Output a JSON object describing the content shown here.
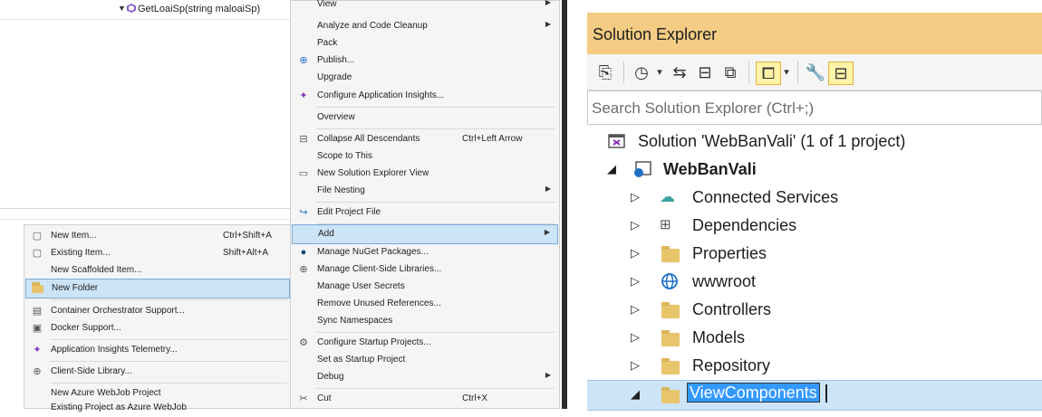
{
  "editor": {
    "nav_method": "GetLoaiSp(string maloaiSp)"
  },
  "context_menu": {
    "items": [
      {
        "label": "View",
        "shortcut": "",
        "submenu": true
      },
      {
        "label": "Analyze and Code Cleanup",
        "shortcut": "",
        "submenu": true
      },
      {
        "label": "Pack",
        "shortcut": "",
        "submenu": false
      },
      {
        "label": "Publish...",
        "shortcut": "",
        "submenu": false,
        "icon": "publish-globe-icon"
      },
      {
        "label": "Upgrade",
        "shortcut": "",
        "submenu": false
      },
      {
        "label": "Configure Application Insights...",
        "shortcut": "",
        "submenu": false,
        "icon": "app-insights-icon"
      },
      {
        "label": "Overview",
        "shortcut": "",
        "submenu": false
      },
      {
        "label": "Collapse All Descendants",
        "shortcut": "Ctrl+Left Arrow",
        "submenu": false,
        "icon": "collapse-icon"
      },
      {
        "label": "Scope to This",
        "shortcut": "",
        "submenu": false
      },
      {
        "label": "New Solution Explorer View",
        "shortcut": "",
        "submenu": false,
        "icon": "new-view-icon"
      },
      {
        "label": "File Nesting",
        "shortcut": "",
        "submenu": true
      },
      {
        "label": "Edit Project File",
        "shortcut": "",
        "submenu": false,
        "icon": "edit-file-icon"
      },
      {
        "label": "Add",
        "shortcut": "",
        "submenu": true,
        "highlighted": true
      },
      {
        "label": "Manage NuGet Packages...",
        "shortcut": "",
        "submenu": false,
        "icon": "nuget-icon"
      },
      {
        "label": "Manage Client-Side Libraries...",
        "shortcut": "",
        "submenu": false,
        "icon": "client-lib-icon"
      },
      {
        "label": "Manage User Secrets",
        "shortcut": "",
        "submenu": false
      },
      {
        "label": "Remove Unused References...",
        "shortcut": "",
        "submenu": false
      },
      {
        "label": "Sync Namespaces",
        "shortcut": "",
        "submenu": false
      },
      {
        "label": "Configure Startup Projects...",
        "shortcut": "",
        "submenu": false,
        "icon": "gear-icon"
      },
      {
        "label": "Set as Startup Project",
        "shortcut": "",
        "submenu": false
      },
      {
        "label": "Debug",
        "shortcut": "",
        "submenu": true
      },
      {
        "label": "Cut",
        "shortcut": "Ctrl+X",
        "submenu": false,
        "icon": "scissors-icon"
      }
    ]
  },
  "add_submenu": {
    "items": [
      {
        "label": "New Item...",
        "shortcut": "Ctrl+Shift+A",
        "icon": "new-item-icon"
      },
      {
        "label": "Existing Item...",
        "shortcut": "Shift+Alt+A",
        "icon": "existing-item-icon"
      },
      {
        "label": "New Scaffolded Item...",
        "shortcut": ""
      },
      {
        "label": "New Folder",
        "shortcut": "",
        "icon": "folder-icon",
        "highlighted": true
      },
      {
        "label": "Container Orchestrator Support...",
        "shortcut": "",
        "icon": "container-icon"
      },
      {
        "label": "Docker Support...",
        "shortcut": "",
        "icon": "docker-icon"
      },
      {
        "label": "Application Insights Telemetry...",
        "shortcut": "",
        "icon": "app-insights-icon"
      },
      {
        "label": "Client-Side Library...",
        "shortcut": "",
        "icon": "client-lib-icon"
      },
      {
        "label": "New Azure WebJob Project",
        "shortcut": ""
      },
      {
        "label": "Existing Project as Azure WebJob",
        "shortcut": ""
      }
    ]
  },
  "solution_explorer": {
    "title": "Solution Explorer",
    "search_placeholder": "Search Solution Explorer (Ctrl+;)",
    "solution_label": "Solution 'WebBanVali' (1 of 1 project)",
    "project_label": "WebBanVali",
    "nodes": [
      {
        "label": "Connected Services",
        "icon": "connected-services-icon"
      },
      {
        "label": "Dependencies",
        "icon": "dependencies-icon"
      },
      {
        "label": "Properties",
        "icon": "properties-icon"
      },
      {
        "label": "wwwroot",
        "icon": "globe-icon"
      },
      {
        "label": "Controllers",
        "icon": "folder-icon"
      },
      {
        "label": "Models",
        "icon": "folder-icon"
      },
      {
        "label": "Repository",
        "icon": "folder-icon"
      }
    ],
    "editing_node": "ViewComponents",
    "accent_color": "#f5cc84",
    "selection_color": "#cce4f7"
  }
}
